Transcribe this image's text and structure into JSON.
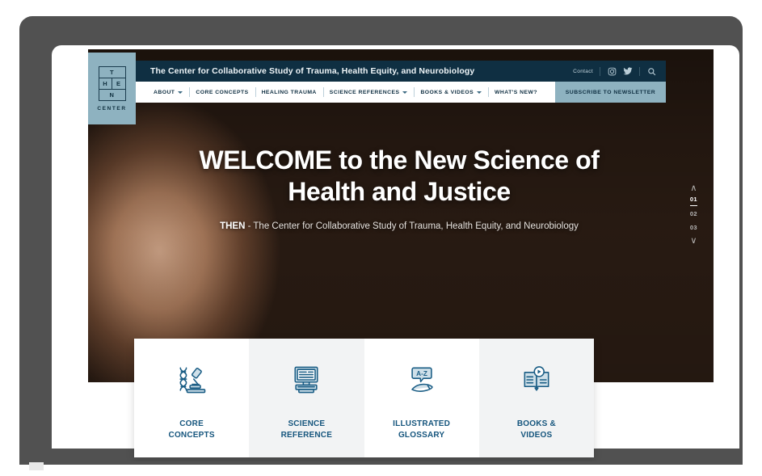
{
  "site": {
    "logo": {
      "cells": [
        "T",
        "H",
        "E",
        "N"
      ],
      "caption": "CENTER",
      "bg_color": "#8eb2c0"
    },
    "topbar": {
      "title": "The Center for Collaborative Study of Trauma, Health Equity, and Neurobiology",
      "contact_label": "Contact",
      "icons": [
        "instagram-icon",
        "twitter-icon",
        "search-icon"
      ],
      "bg_color": "#0f2f42"
    },
    "nav": {
      "items": [
        {
          "label": "ABOUT",
          "has_dropdown": true
        },
        {
          "label": "CORE CONCEPTS",
          "has_dropdown": false
        },
        {
          "label": "HEALING TRAUMA",
          "has_dropdown": false
        },
        {
          "label": "SCIENCE REFERENCES",
          "has_dropdown": true
        },
        {
          "label": "BOOKS & VIDEOS",
          "has_dropdown": true
        },
        {
          "label": "WHAT'S NEW?",
          "has_dropdown": false
        }
      ],
      "subscribe_label": "SUBSCRIBE TO NEWSLETTER",
      "subscribe_bg": "#8eb2c0"
    },
    "hero": {
      "title": "WELCOME to the New Science of Health and Justice",
      "subtitle_strong": "THEN",
      "subtitle_rest": " - The Center for Collaborative Study of Trauma, Health Equity, and Neurobiology"
    },
    "slider": {
      "up_glyph": "∧",
      "down_glyph": "∨",
      "slides": [
        "01",
        "02",
        "03"
      ],
      "active_index": 0
    },
    "cards": [
      {
        "icon": "microscope-dna-icon",
        "label": "CORE\nCONCEPTS",
        "style": "plain"
      },
      {
        "icon": "computer-monitor-icon",
        "label": "SCIENCE\nREFERENCE",
        "style": "alt"
      },
      {
        "icon": "a-to-z-pen-icon",
        "label": "ILLUSTRATED\nGLOSSARY",
        "style": "plain"
      },
      {
        "icon": "open-book-play-icon",
        "label": "BOOKS &\nVIDEOS",
        "style": "alt"
      }
    ],
    "accent_color": "#15557d",
    "frame_color": "#515151"
  }
}
